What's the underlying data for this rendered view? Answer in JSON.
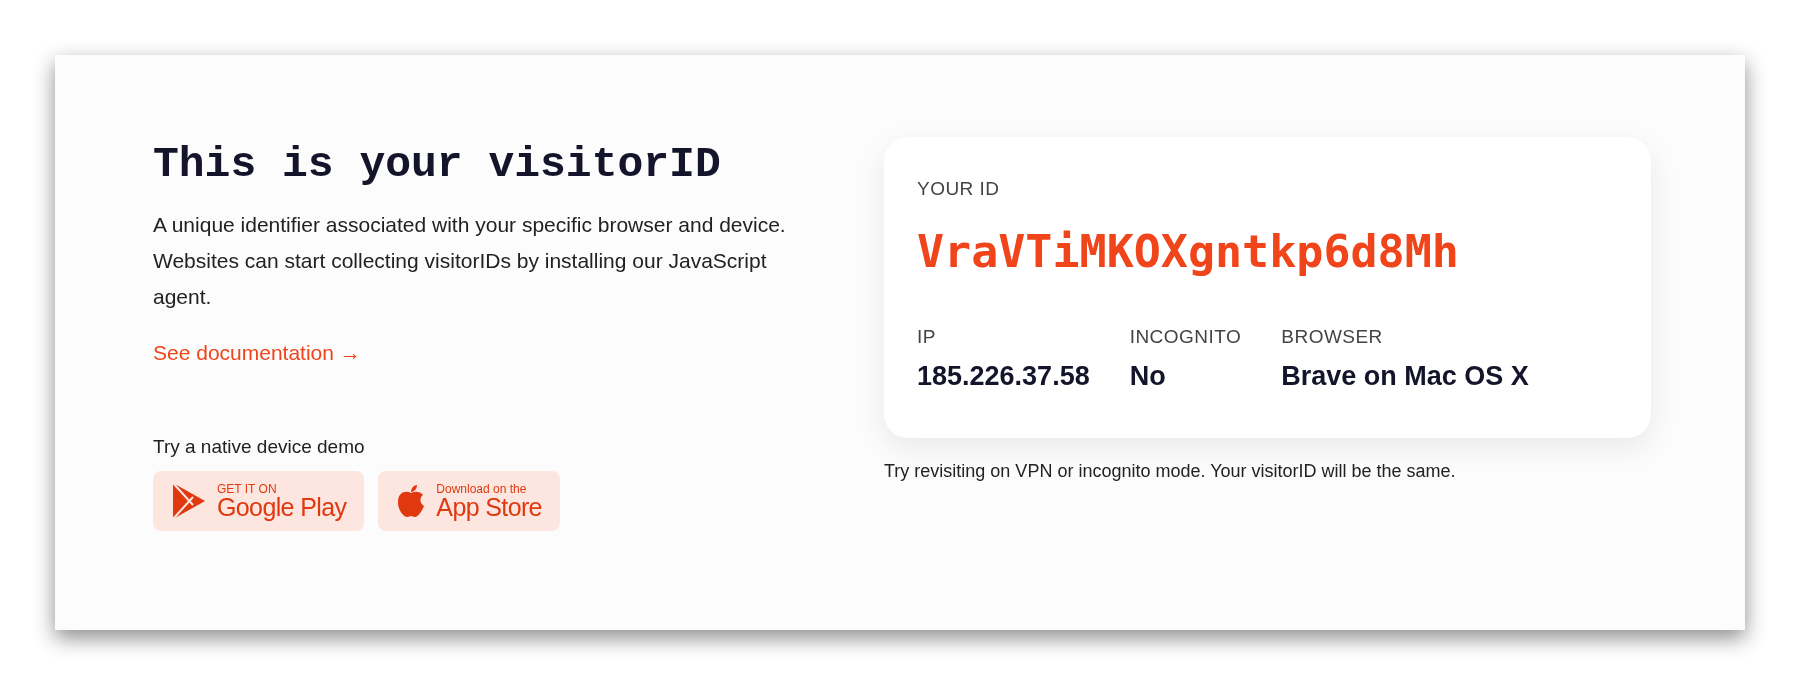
{
  "intro": {
    "title": "This is your visitorID",
    "description": "A unique identifier associated with your specific browser and device. Websites can start collecting visitorIDs by installing our JavaScript agent.",
    "link": "See documentation →"
  },
  "demo": {
    "label": "Try a native device demo",
    "stores": [
      {
        "kind": "google",
        "small": "GET IT ON",
        "big": "Google Play"
      },
      {
        "kind": "apple",
        "small": "Download on the",
        "big": "App Store"
      }
    ]
  },
  "id_card": {
    "label": "YOUR ID",
    "visitor_id": "VraVTiMKOXgntkp6d8Mh",
    "fields": [
      {
        "label": "IP",
        "value": "185.226.37.58"
      },
      {
        "label": "INCOGNITO",
        "value": "No"
      },
      {
        "label": "BROWSER",
        "value": "Brave on Mac OS X"
      }
    ]
  },
  "note": "Try revisiting on VPN or incognito mode. Your visitorID will be the same."
}
